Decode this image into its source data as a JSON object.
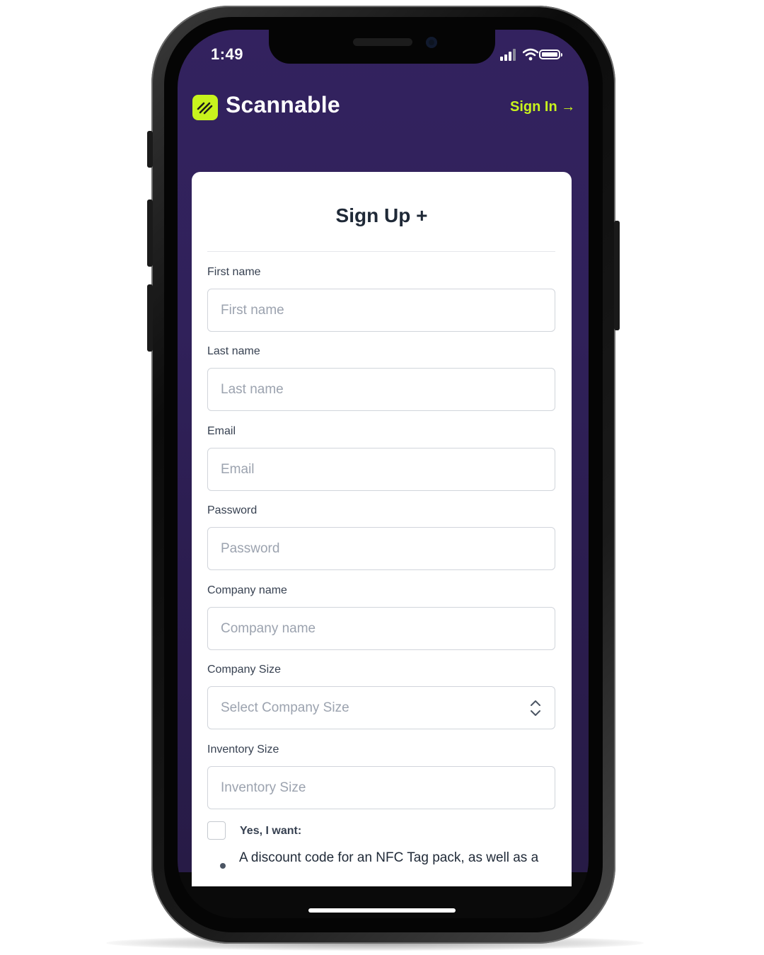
{
  "status_bar": {
    "time": "1:49"
  },
  "header": {
    "brand_name": "Scannable",
    "sign_in_label": "Sign In →"
  },
  "form": {
    "title": "Sign Up +",
    "fields": [
      {
        "label": "First name",
        "placeholder": "First name",
        "value": ""
      },
      {
        "label": "Last name",
        "placeholder": "Last name",
        "value": ""
      },
      {
        "label": "Email",
        "placeholder": "Email",
        "value": ""
      },
      {
        "label": "Password",
        "placeholder": "Password",
        "value": ""
      },
      {
        "label": "Company name",
        "placeholder": "Company name",
        "value": ""
      }
    ],
    "company_size": {
      "label": "Company Size",
      "selected": "Select Company Size"
    },
    "inventory_size": {
      "label": "Inventory Size",
      "placeholder": "Inventory Size",
      "value": ""
    },
    "opt_in": {
      "label": "Yes, I want:",
      "checked": false,
      "bullet": "A discount code for an NFC Tag pack, as well as a"
    }
  },
  "colors": {
    "brand_bg": "#33225f",
    "accent": "#c8f31d",
    "card_bg": "#ffffff"
  },
  "icons": [
    "signal-icon",
    "wifi-icon",
    "battery-icon",
    "scannable-logo-icon",
    "arrow-right-icon",
    "select-chevrons-icon"
  ]
}
